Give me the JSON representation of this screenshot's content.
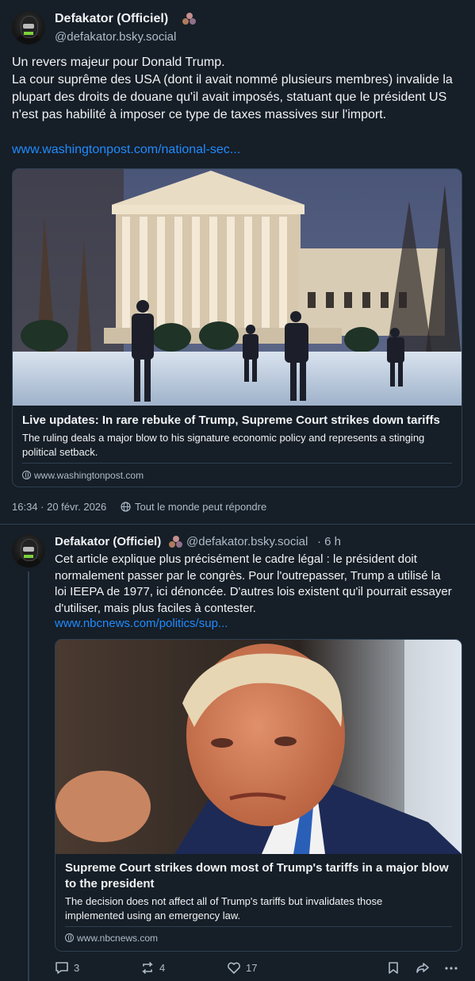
{
  "post": {
    "author_name": "Defakator (Officiel)",
    "handle": "@defakator.bsky.social",
    "text": "Un revers majeur pour Donald Trump.\nLa cour suprême des USA (dont il avait nommé plusieurs membres) invalide la plupart des droits de douane qu'il avait imposés, statuant que le président US n'est pas habilité à imposer ce type de taxes massives sur l'import.",
    "link": "www.washingtonpost.com/national-sec...",
    "card": {
      "image": "supreme-court-building-snow",
      "title": "Live updates: In rare rebuke of Trump, Supreme Court strikes down tariffs",
      "description": "The ruling deals a major blow to his signature economic policy and represents a stinging political setback.",
      "domain": "www.washingtonpost.com"
    },
    "timestamp": "16:34 · 20 févr. 2026",
    "reply_setting": "Tout le monde peut répondre"
  },
  "reply": {
    "author_name": "Defakator (Officiel)",
    "handle": "@defakator.bsky.social",
    "age": "· 6 h",
    "text": "Cet article explique plus précisément le cadre légal : le président doit normalement passer par le congrès. Pour l'outrepasser, Trump a utilisé la loi IEEPA de 1977, ici dénoncée. D'autres lois existent qu'il pourrait essayer d'utiliser, mais plus faciles à contester.",
    "link": "www.nbcnews.com/politics/sup...",
    "card": {
      "image": "donald-trump-portrait",
      "title": "Supreme Court strikes down most of Trump's tariffs in a major blow to the president",
      "description": "The decision does not affect all of Trump's tariffs but invalidates those implemented using an emergency law.",
      "domain": "www.nbcnews.com"
    },
    "actions": {
      "replies": "3",
      "reposts": "4",
      "likes": "17"
    }
  },
  "colors": {
    "background": "#161e27",
    "link": "#208bfe",
    "muted": "#aebbc9",
    "border": "#2e4052"
  }
}
